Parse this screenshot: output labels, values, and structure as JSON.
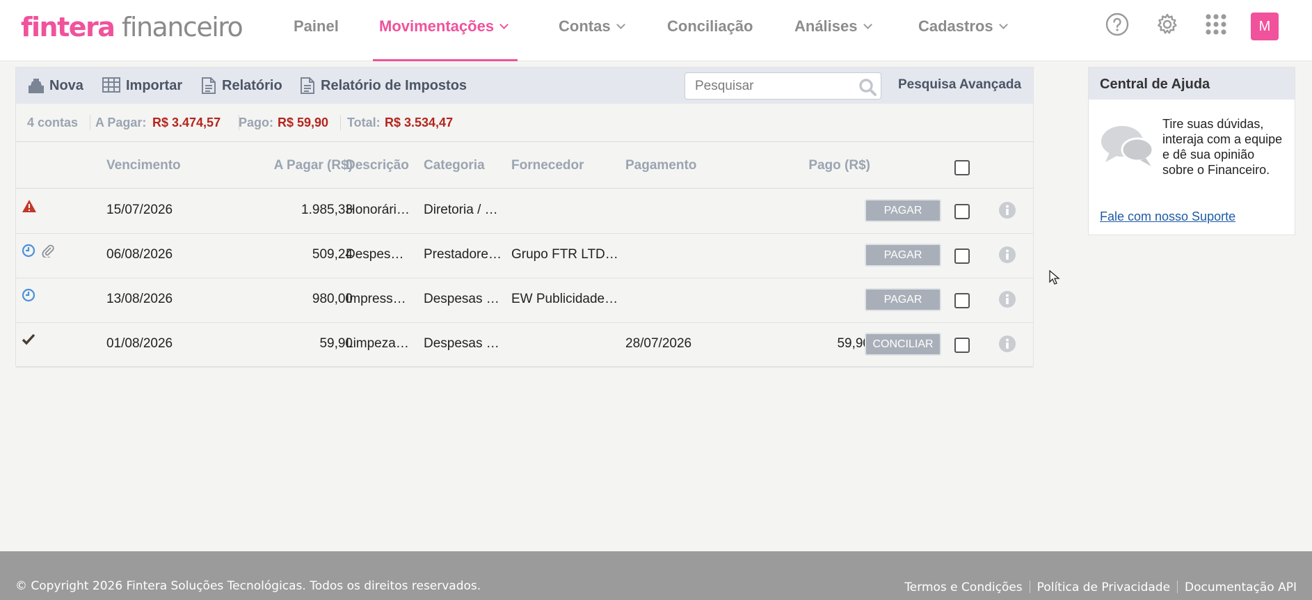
{
  "header": {
    "logo_brand": "fintera",
    "logo_product": "financeiro",
    "nav": [
      {
        "label": "Painel"
      },
      {
        "label": "Movimentações"
      },
      {
        "label": "Contas"
      },
      {
        "label": "Conciliação"
      },
      {
        "label": "Análises"
      },
      {
        "label": "Cadastros"
      }
    ],
    "active_nav": "Movimentações",
    "icons": [
      "help-icon",
      "gear-icon",
      "apps-grid-icon"
    ],
    "avatar_initial": "M"
  },
  "toolbar": {
    "nova": "Nova",
    "importar": "Importar",
    "relatorio": "Relatório",
    "relatorio_impostos": "Relatório de Impostos",
    "search_placeholder": "Pesquisar",
    "advanced_search": "Pesquisa Avançada"
  },
  "summary": {
    "count": "4 contas",
    "a_pagar_label": "A Pagar:",
    "a_pagar_value": "R$ 3.474,57",
    "pago_label": "Pago:",
    "pago_value": "R$ 59,90",
    "total_label": "Total:",
    "total_value": "R$ 3.534,47"
  },
  "table": {
    "columns": {
      "vencimento": "Vencimento",
      "a_pagar": "A Pagar (R$)",
      "descricao": "Descrição",
      "categoria": "Categoria",
      "fornecedor": "Fornecedor",
      "pagamento": "Pagamento",
      "pago": "Pago (R$)"
    },
    "rows": [
      {
        "status": [
          "warning-icon"
        ],
        "vencimento": "15/07/2026",
        "a_pagar": "1.985,33",
        "descricao": "Honorári…",
        "categoria": "Diretoria / …",
        "fornecedor": "",
        "pagamento": "",
        "pago": "",
        "action": "PAGAR"
      },
      {
        "status": [
          "clock-icon",
          "paperclip-icon"
        ],
        "vencimento": "06/08/2026",
        "a_pagar": "509,24",
        "descricao": "Despes…",
        "categoria": "Prestadore…",
        "fornecedor": "Grupo FTR LTD…",
        "pagamento": "",
        "pago": "",
        "action": "PAGAR"
      },
      {
        "status": [
          "clock-icon"
        ],
        "vencimento": "13/08/2026",
        "a_pagar": "980,00",
        "descricao": "Impress…",
        "categoria": "Despesas …",
        "fornecedor": "EW Publicidade…",
        "pagamento": "",
        "pago": "",
        "action": "PAGAR"
      },
      {
        "status": [
          "check-icon"
        ],
        "vencimento": "01/08/2026",
        "a_pagar": "59,90",
        "descricao": "Limpeza…",
        "categoria": "Despesas …",
        "fornecedor": "",
        "pagamento": "28/07/2026",
        "pago": "59,90",
        "action": "CONCILIAR"
      }
    ]
  },
  "help": {
    "title": "Central de Ajuda",
    "text": "Tire suas dúvidas, interaja com a equipe e dê sua opinião sobre o Financeiro.",
    "link": "Fale com nosso Suporte"
  },
  "footer": {
    "copyright": "© Copyright 2026 Fintera Soluções Tecnológicas. Todos os direitos reservados.",
    "links": [
      "Termos e Condições",
      "Política de Privacidade",
      "Documentação API"
    ]
  },
  "colors": {
    "brand": "#f0529c",
    "amount_red": "#b3261e",
    "toolbar_bg": "#e4e7ee",
    "footer_bg": "#9b9b9b"
  }
}
